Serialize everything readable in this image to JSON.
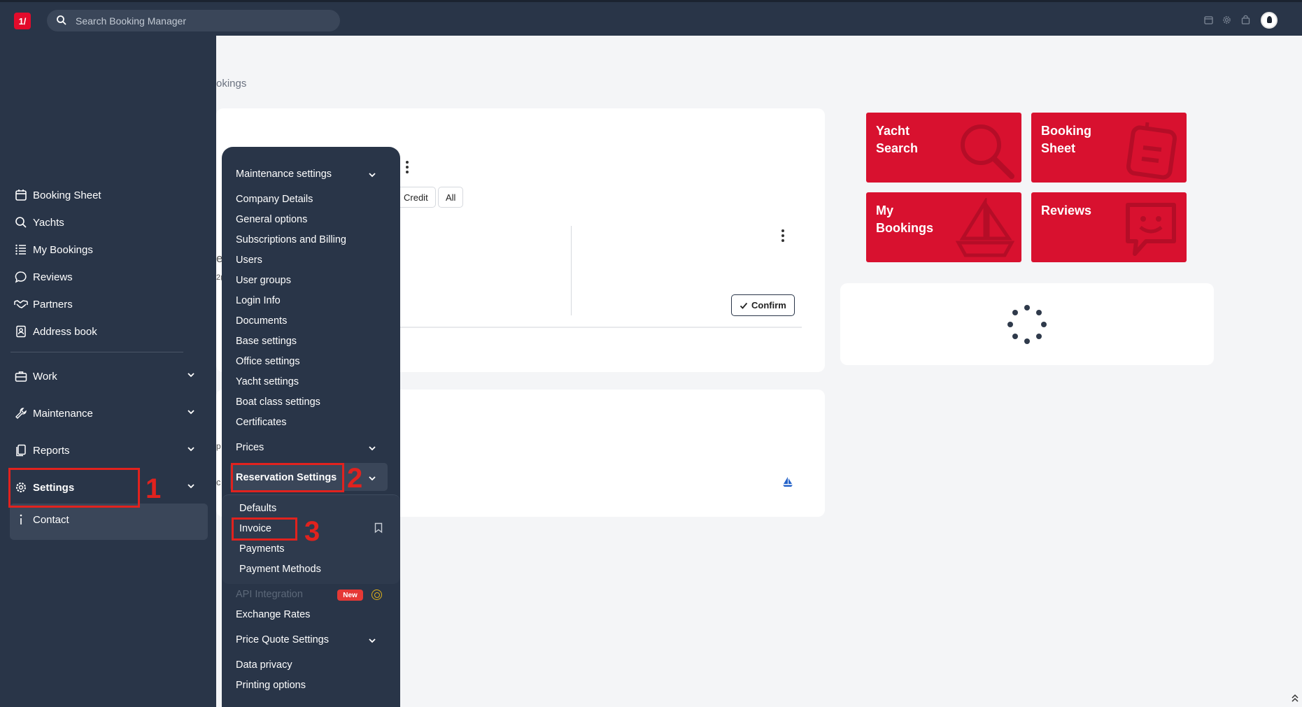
{
  "topbar": {
    "logo_text": "1/",
    "search_placeholder": "Search Booking Manager",
    "icons": [
      "calendar-icon",
      "gear-icon",
      "bag-icon",
      "user-avatar"
    ]
  },
  "sidebar": {
    "items": [
      {
        "label": "Booking Sheet",
        "icon": "calendar-icon"
      },
      {
        "label": "Yachts",
        "icon": "search-icon"
      },
      {
        "label": "My Bookings",
        "icon": "list-icon"
      },
      {
        "label": "Reviews",
        "icon": "chat-icon"
      },
      {
        "label": "Partners",
        "icon": "handshake-icon"
      },
      {
        "label": "Address book",
        "icon": "address-book-icon"
      }
    ],
    "groups": [
      {
        "label": "Work",
        "icon": "briefcase-icon"
      },
      {
        "label": "Maintenance",
        "icon": "wrench-icon"
      },
      {
        "label": "Reports",
        "icon": "documents-icon"
      },
      {
        "label": "Settings",
        "icon": "gear-icon"
      }
    ],
    "contact": {
      "label": "Contact",
      "icon": "info-icon"
    }
  },
  "main": {
    "breadcrumb_fragment": "okings",
    "filters": [
      "Credit",
      "All"
    ],
    "confirm_label": "Confirm",
    "fragments": [
      "e",
      "2(",
      "p",
      "c"
    ]
  },
  "tiles": [
    {
      "label": "Yacht Search",
      "icon": "magnifier-icon"
    },
    {
      "label": "Booking Sheet",
      "icon": "robot-icon"
    },
    {
      "label": "My Bookings",
      "icon": "sailboat-icon"
    },
    {
      "label": "Reviews",
      "icon": "smile-chat-icon"
    }
  ],
  "flyout": {
    "items": [
      {
        "label": "Maintenance settings",
        "expandable": true
      },
      {
        "label": "Company Details"
      },
      {
        "label": "General options"
      },
      {
        "label": "Subscriptions and Billing"
      },
      {
        "label": "Users"
      },
      {
        "label": "User groups"
      },
      {
        "label": "Login Info"
      },
      {
        "label": "Documents"
      },
      {
        "label": "Base settings"
      },
      {
        "label": "Office settings"
      },
      {
        "label": "Yacht settings"
      },
      {
        "label": "Boat class settings"
      },
      {
        "label": "Certificates"
      },
      {
        "label": "Prices",
        "expandable": true
      },
      {
        "label": "Reservation Settings",
        "expandable": true,
        "active": true
      }
    ],
    "sub_items": [
      {
        "label": "Defaults"
      },
      {
        "label": "Invoice"
      },
      {
        "label": "Payments"
      },
      {
        "label": "Payment Methods"
      }
    ],
    "after_items": [
      {
        "label": "API Integration",
        "badge": "New",
        "disabled": true
      },
      {
        "label": "Exchange Rates"
      },
      {
        "label": "Price Quote Settings",
        "expandable": true
      },
      {
        "label": "Data privacy"
      },
      {
        "label": "Printing options"
      }
    ]
  },
  "annotations": [
    "1",
    "2",
    "3"
  ],
  "colors": {
    "navy": "#293548",
    "brand_red": "#d8112f",
    "annotation_red": "#e1221e"
  }
}
